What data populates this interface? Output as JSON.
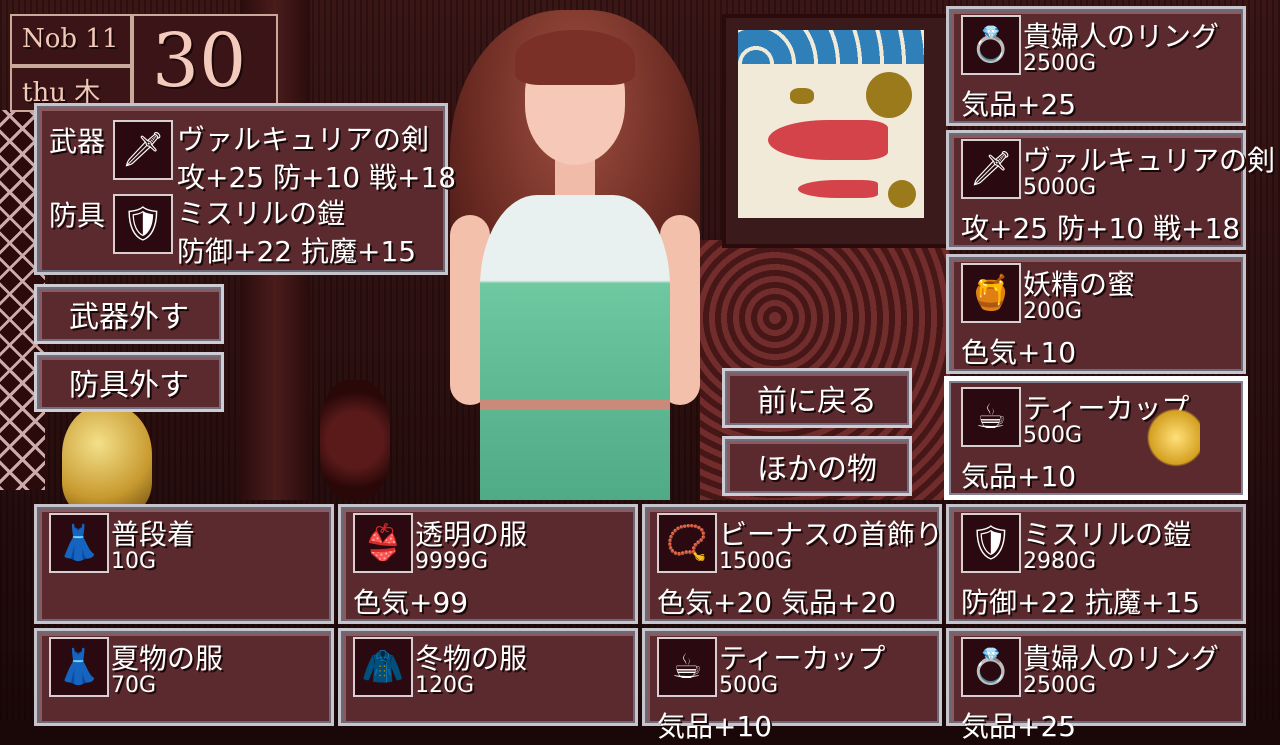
{
  "date": {
    "month": "Nob 11",
    "weekday": "thu 木",
    "day": "30"
  },
  "equipped": {
    "weapon_label": "武器",
    "weapon_name": "ヴァルキュリアの剣",
    "weapon_stats": "攻+25 防+10 戦+18",
    "armor_label": "防具",
    "armor_name": "ミスリルの鎧",
    "armor_stats": "防御+22 抗魔+15"
  },
  "actions": {
    "unequip_weapon": "武器外す",
    "unequip_armor": "防具外す",
    "back": "前に戻る",
    "other_items": "ほかの物"
  },
  "right_column": [
    {
      "name": "貴婦人のリング",
      "price": "2500G",
      "stat": "気品+25",
      "icon": "ring-icon"
    },
    {
      "name": "ヴァルキュリアの剣",
      "price": "5000G",
      "stat": "攻+25 防+10 戦+18",
      "icon": "sword-icon"
    },
    {
      "name": "妖精の蜜",
      "price": "200G",
      "stat": "色気+10",
      "icon": "honey-bottle-icon"
    },
    {
      "name": "ティーカップ",
      "price": "500G",
      "stat": "気品+10",
      "icon": "teacup-icon"
    }
  ],
  "grid_row1": [
    {
      "name": "普段着",
      "price": "10G",
      "stat": "",
      "icon": "pink-dress-icon"
    },
    {
      "name": "透明の服",
      "price": "9999G",
      "stat": "色気+99",
      "icon": "sheer-dress-icon"
    },
    {
      "name": "ビーナスの首飾り",
      "price": "1500G",
      "stat": "色気+20 気品+20",
      "icon": "necklace-icon"
    },
    {
      "name": "ミスリルの鎧",
      "price": "2980G",
      "stat": "防御+22 抗魔+15",
      "icon": "armor-icon"
    }
  ],
  "grid_row2": [
    {
      "name": "夏物の服",
      "price": "70G",
      "stat": "",
      "icon": "summer-dress-icon"
    },
    {
      "name": "冬物の服",
      "price": "120G",
      "stat": "",
      "icon": "winter-coat-icon"
    },
    {
      "name": "ティーカップ",
      "price": "500G",
      "stat": "気品+10",
      "icon": "teacup-icon"
    },
    {
      "name": "貴婦人のリング",
      "price": "2500G",
      "stat": "気品+25",
      "icon": "ring-icon"
    }
  ],
  "colors": {
    "panel": "#5a2a2e",
    "border": "#c8c4cc",
    "text": "#ffffff"
  }
}
